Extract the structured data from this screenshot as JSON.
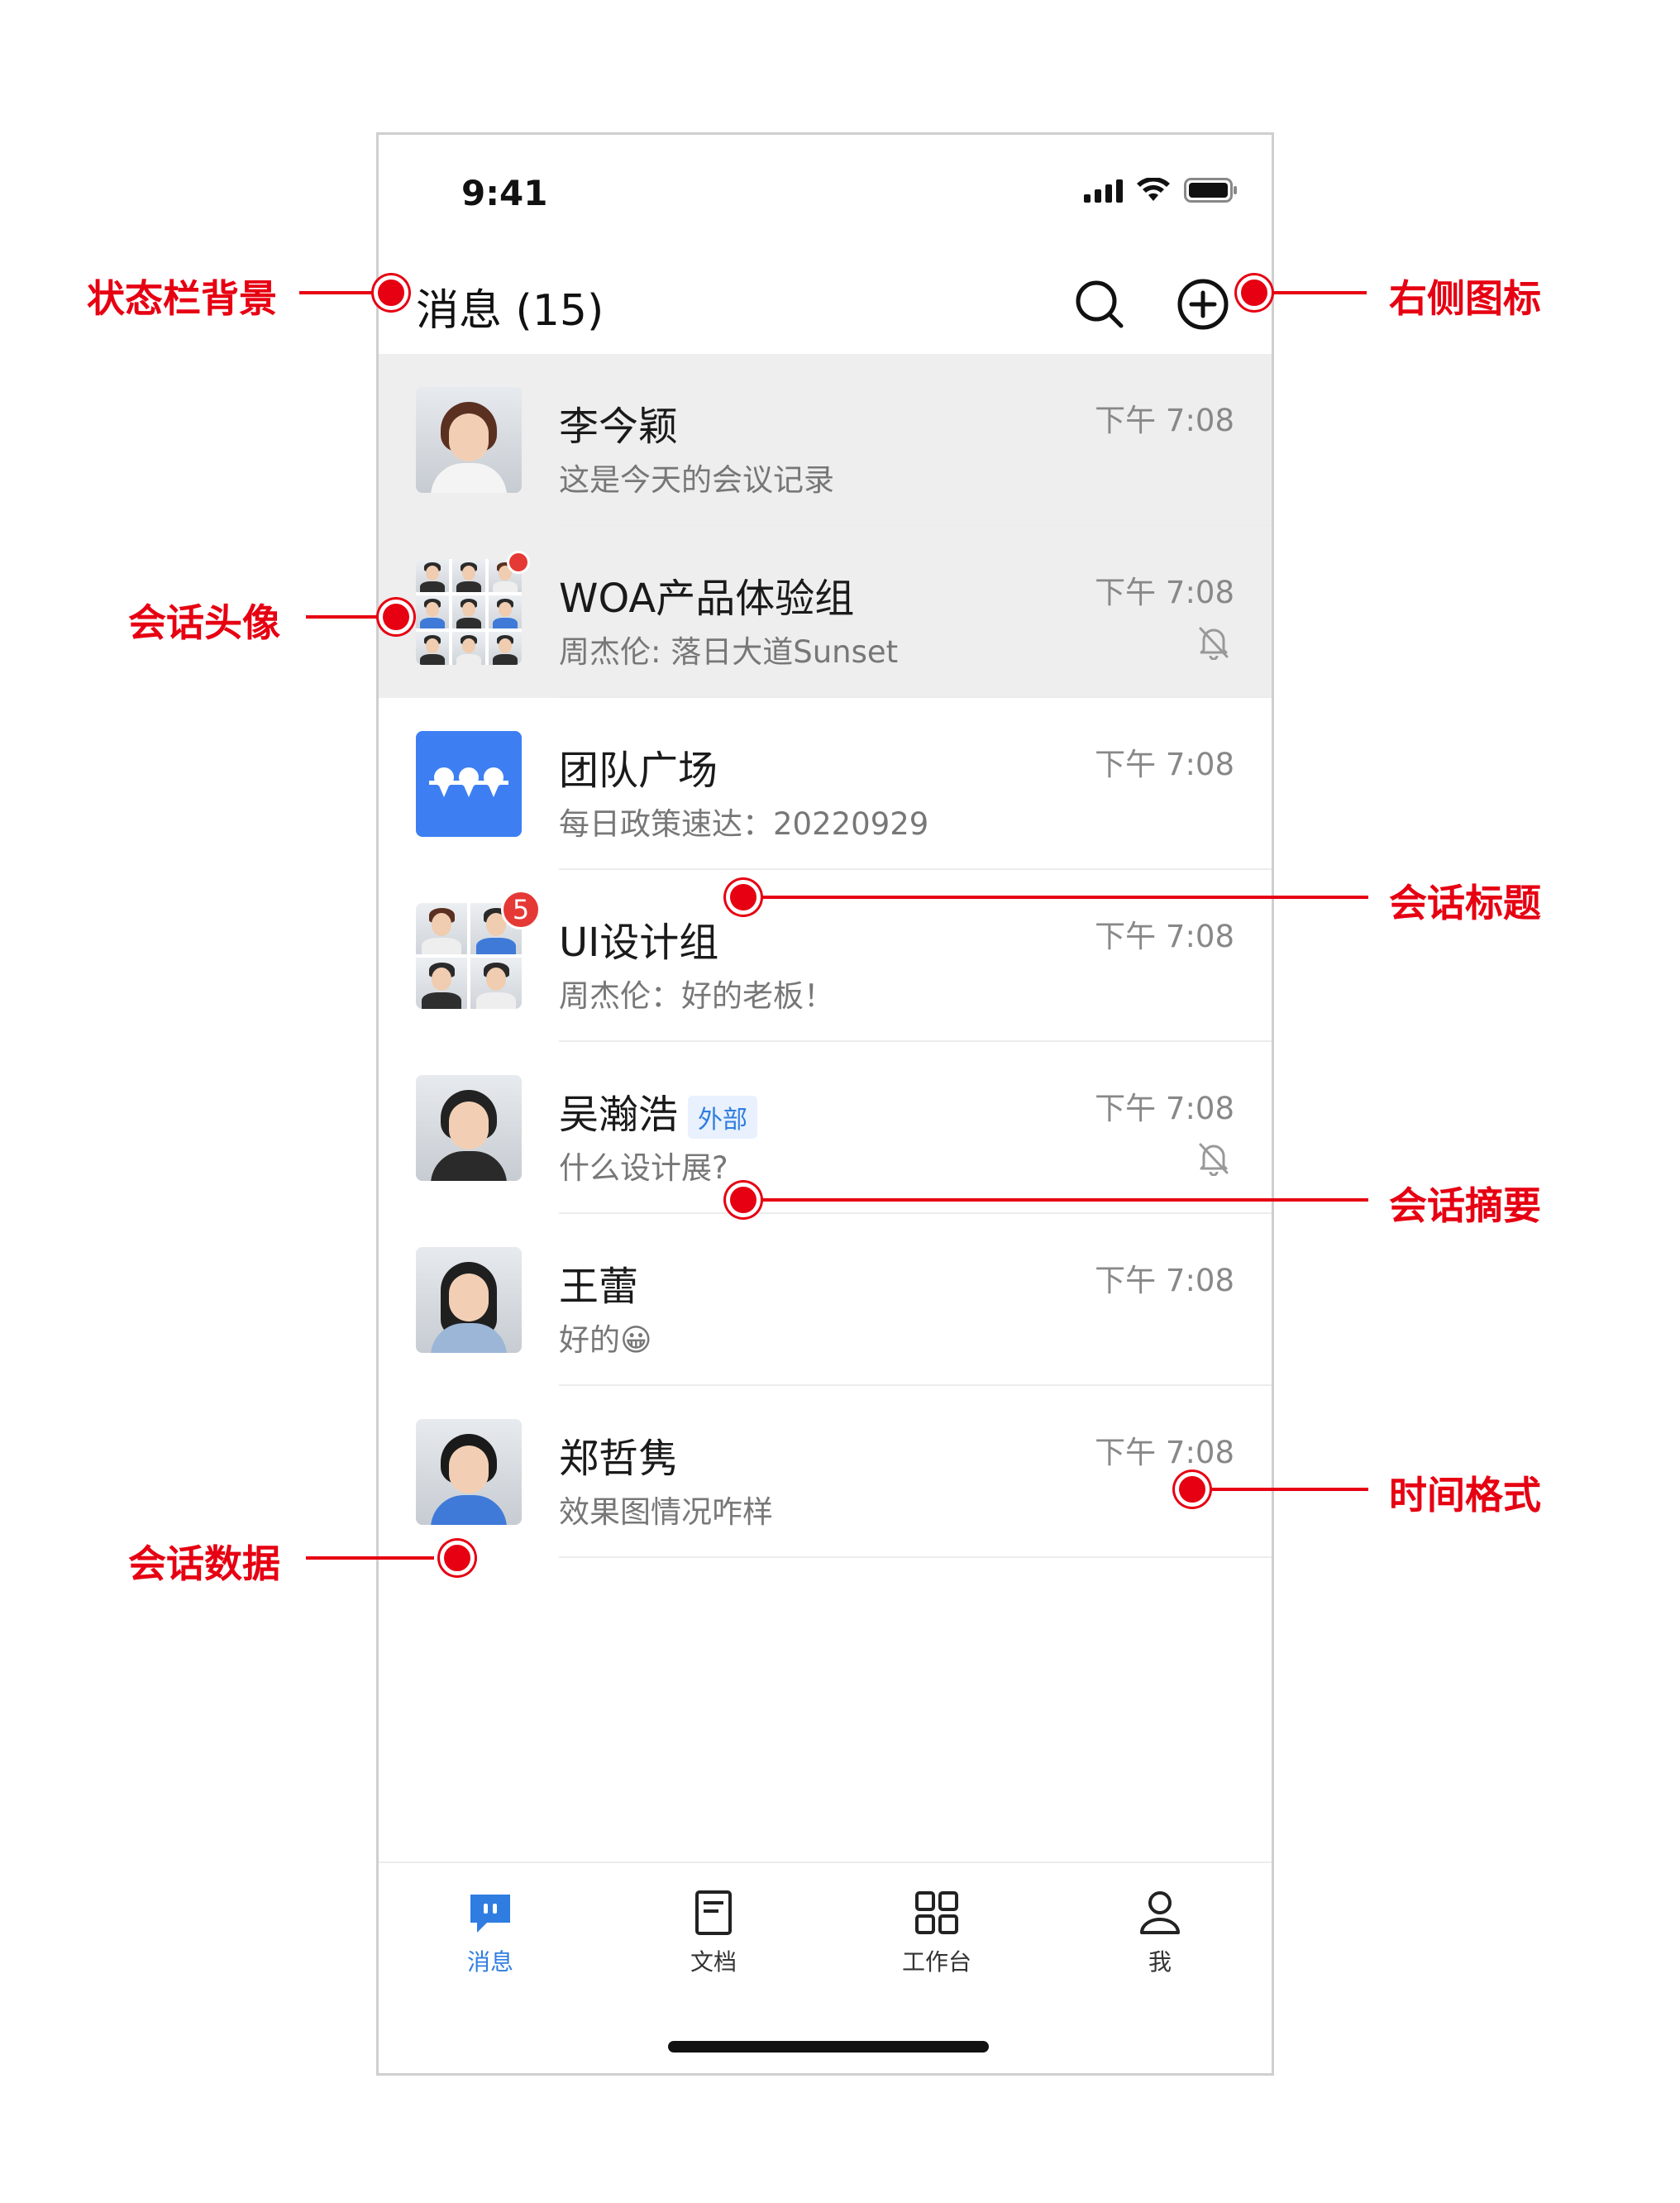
{
  "status_bar": {
    "time": "9:41"
  },
  "header": {
    "title": "消息 (15)"
  },
  "conversations": [
    {
      "title": "李今颖",
      "summary": "这是今天的会议记录",
      "time": "下午 7:08"
    },
    {
      "title": "WOA产品体验组",
      "summary": "周杰伦: 落日大道Sunset",
      "time": "下午 7:08",
      "muted": true,
      "unread_dot": true
    },
    {
      "title": "团队广场",
      "summary": "每日政策速达：20220929",
      "time": "下午 7:08"
    },
    {
      "title": "UI设计组",
      "summary": "周杰伦：好的老板！",
      "time": "下午 7:08",
      "unread_count": "5"
    },
    {
      "title": "吴瀚浩",
      "tag": "外部",
      "summary": "什么设计展?",
      "time": "下午 7:08",
      "muted": true
    },
    {
      "title": "王蕾",
      "summary": "好的😀",
      "time": "下午 7:08"
    },
    {
      "title": "郑哲隽",
      "summary": "效果图情况咋样",
      "time": "下午 7:08"
    }
  ],
  "tab_bar": {
    "items": [
      {
        "label": "消息",
        "icon": "message-icon",
        "active": true
      },
      {
        "label": "文档",
        "icon": "document-icon"
      },
      {
        "label": "工作台",
        "icon": "workspace-grid-icon"
      },
      {
        "label": "我",
        "icon": "profile-icon"
      }
    ]
  },
  "annotations": {
    "status_bar_bg": "状态栏背景",
    "right_icons": "右侧图标",
    "conv_avatar": "会话头像",
    "conv_title": "会话标题",
    "conv_summary": "会话摘要",
    "time_format": "时间格式",
    "conv_data": "会话数据"
  },
  "colors": {
    "accent": "#2f7de1",
    "annotation_red": "#e60012",
    "badge_red": "#e53935",
    "highlight_bg": "#eeeeee"
  }
}
